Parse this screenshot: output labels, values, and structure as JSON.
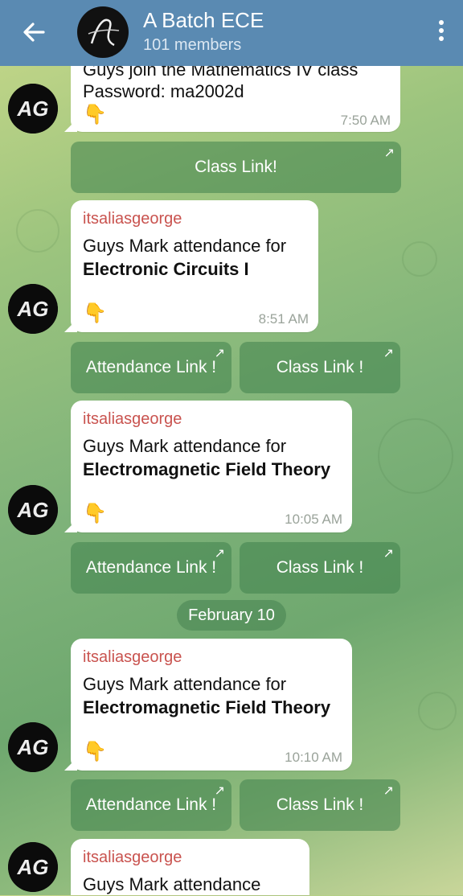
{
  "header": {
    "title": "A Batch ECE",
    "subtitle": "101 members",
    "back_icon": "arrow-left-icon",
    "menu_icon": "more-vertical-icon"
  },
  "messages": [
    {
      "text_line1": "Guys join the Mathematics IV class",
      "text_line2": "Password: ma2002d",
      "emoji": "👇",
      "time": "7:50 AM",
      "buttons": [
        "Class Link!"
      ]
    },
    {
      "sender": "itsaliasgeorge",
      "text_line1": "Guys Mark attendance for",
      "text_line2": "Electronic Circuits I",
      "emoji": "👇",
      "time": "8:51 AM",
      "buttons": [
        "Attendance Link !",
        "Class Link !"
      ]
    },
    {
      "sender": "itsaliasgeorge",
      "text_line1": "Guys Mark attendance for",
      "text_line2": "Electromagnetic Field Theory",
      "emoji": "👇",
      "time": "10:05 AM",
      "buttons": [
        "Attendance Link !",
        "Class Link !"
      ]
    },
    {
      "sender": "itsaliasgeorge",
      "text_line1": "Guys Mark attendance for",
      "text_line2": "Electromagnetic Field Theory",
      "emoji": "👇",
      "time": "10:10 AM",
      "buttons": [
        "Attendance Link !",
        "Class Link !"
      ]
    },
    {
      "sender": "itsaliasgeorge",
      "text_line1": "Guys Mark attendance"
    }
  ],
  "date_separator": "February 10",
  "avatar_initials": "AG",
  "link_arrow": "↗",
  "colors": {
    "header": "#5a8ab2",
    "sender": "#c9534f",
    "button_bg": "#40824c"
  }
}
